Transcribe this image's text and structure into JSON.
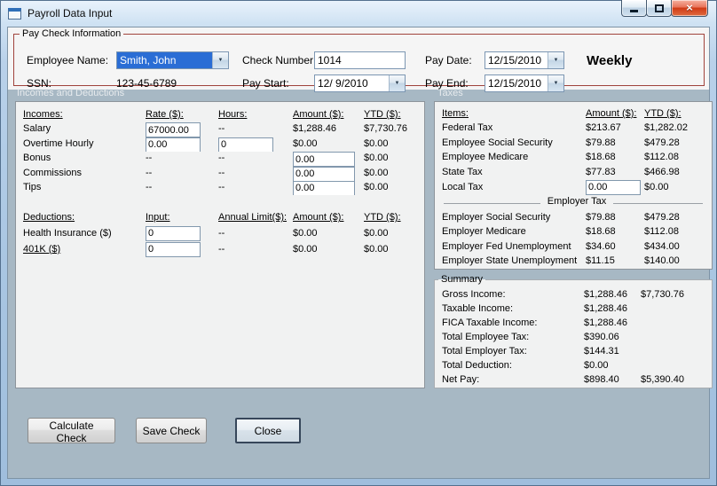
{
  "window": {
    "title": "Payroll Data Input"
  },
  "icons": {
    "dropdown_arrow": "▼",
    "close_glyph": "×"
  },
  "paycheck": {
    "group_label": "Pay Check Information",
    "employee_name_label": "Employee Name:",
    "employee_name_value": "Smith, John",
    "ssn_label": "SSN:",
    "ssn_value": "123-45-6789",
    "check_number_label": "Check Number:",
    "check_number_value": "1014",
    "pay_start_label": "Pay Start:",
    "pay_start_value": "12/ 9/2010",
    "pay_date_label": "Pay Date:",
    "pay_date_value": "12/15/2010",
    "pay_end_label": "Pay End:",
    "pay_end_value": "12/15/2010",
    "frequency": "Weekly"
  },
  "sections": {
    "incomes_header": "Incomes and Deductions",
    "taxes_header": "Taxes"
  },
  "incomes": {
    "headers": {
      "col1": "Incomes:",
      "col2": "Rate ($):",
      "col3": "Hours:",
      "col4": "Amount ($):",
      "col5": "YTD ($):"
    },
    "rows": [
      {
        "label": "Salary",
        "rate": "67000.00",
        "hours": "--",
        "amount": "$1,288.46",
        "ytd": "$7,730.76"
      },
      {
        "label": "Overtime Hourly",
        "rate": "0.00",
        "hours": "0",
        "amount": "$0.00",
        "ytd": "$0.00"
      },
      {
        "label": "Bonus",
        "rate": "--",
        "hours": "--",
        "amount": "0.00",
        "ytd": "$0.00"
      },
      {
        "label": "Commissions",
        "rate": "--",
        "hours": "--",
        "amount": "0.00",
        "ytd": "$0.00"
      },
      {
        "label": "Tips",
        "rate": "--",
        "hours": "--",
        "amount": "0.00",
        "ytd": "$0.00"
      }
    ]
  },
  "deductions": {
    "headers": {
      "col1": "Deductions:",
      "col2": "Input:",
      "col3": "Annual Limit($):",
      "col4": "Amount ($):",
      "col5": "YTD ($):"
    },
    "rows": [
      {
        "label": "Health Insurance ($)",
        "input": "0",
        "limit": "--",
        "amount": "$0.00",
        "ytd": "$0.00"
      },
      {
        "label": "401K ($)",
        "input": "0",
        "limit": "--",
        "amount": "$0.00",
        "ytd": "$0.00"
      }
    ]
  },
  "taxes": {
    "headers": {
      "col1": "Items:",
      "col2": "Amount ($):",
      "col3": "YTD ($):"
    },
    "employee_rows": [
      {
        "label": "Federal Tax",
        "amount": "$213.67",
        "ytd": "$1,282.02"
      },
      {
        "label": "Employee Social Security",
        "amount": "$79.88",
        "ytd": "$479.28"
      },
      {
        "label": "Employee Medicare",
        "amount": "$18.68",
        "ytd": "$112.08"
      },
      {
        "label": "State Tax",
        "amount": "$77.83",
        "ytd": "$466.98"
      }
    ],
    "local_tax": {
      "label": "Local Tax",
      "amount": "0.00",
      "ytd": "$0.00"
    },
    "employer_divider": "Employer Tax",
    "employer_rows": [
      {
        "label": "Employer Social Security",
        "amount": "$79.88",
        "ytd": "$479.28"
      },
      {
        "label": "Employer Medicare",
        "amount": "$18.68",
        "ytd": "$112.08"
      },
      {
        "label": "Employer Fed Unemployment",
        "amount": "$34.60",
        "ytd": "$434.00"
      },
      {
        "label": "Employer State Unemployment",
        "amount": "$11.15",
        "ytd": "$140.00"
      }
    ]
  },
  "summary": {
    "group_label": "Summary",
    "rows": [
      {
        "label": "Gross Income:",
        "value": "$1,288.46",
        "ytd": "$7,730.76"
      },
      {
        "label": "Taxable Income:",
        "value": "$1,288.46",
        "ytd": ""
      },
      {
        "label": "FICA Taxable Income:",
        "value": "$1,288.46",
        "ytd": ""
      },
      {
        "label": "Total Employee Tax:",
        "value": "$390.06",
        "ytd": ""
      },
      {
        "label": "Total Employer Tax:",
        "value": "$144.31",
        "ytd": ""
      },
      {
        "label": "Total Deduction:",
        "value": "$0.00",
        "ytd": ""
      },
      {
        "label": "Net Pay:",
        "value": "$898.40",
        "ytd": "$5,390.40"
      }
    ]
  },
  "buttons": {
    "calculate": "Calculate Check",
    "save": "Save Check",
    "close": "Close"
  }
}
